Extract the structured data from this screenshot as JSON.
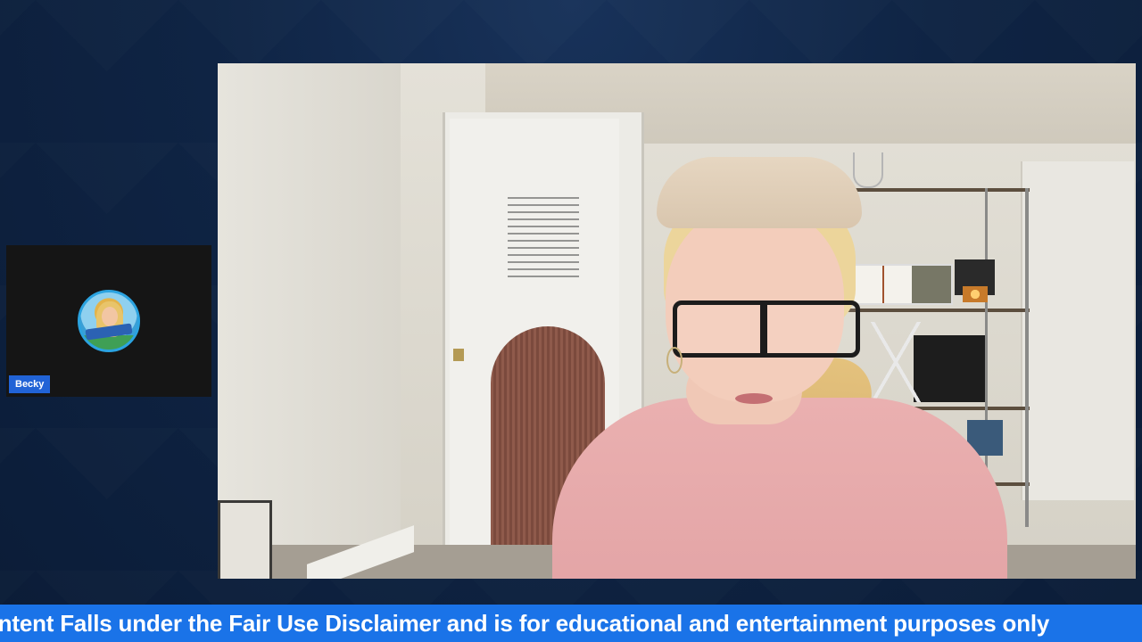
{
  "participants": [
    {
      "name": "Becky",
      "avatar_icon": "profile-avatar-icon"
    }
  ],
  "main_video": {
    "description_icon": "webcam-feed"
  },
  "ticker": {
    "text": "ontent Falls under the Fair Use Disclaimer and is for educational and entertainment purposes only"
  },
  "colors": {
    "background": "#0f2444",
    "name_tag": "#2163d6",
    "ticker_bg": "#1a73e8",
    "ticker_text": "#ffffff"
  }
}
